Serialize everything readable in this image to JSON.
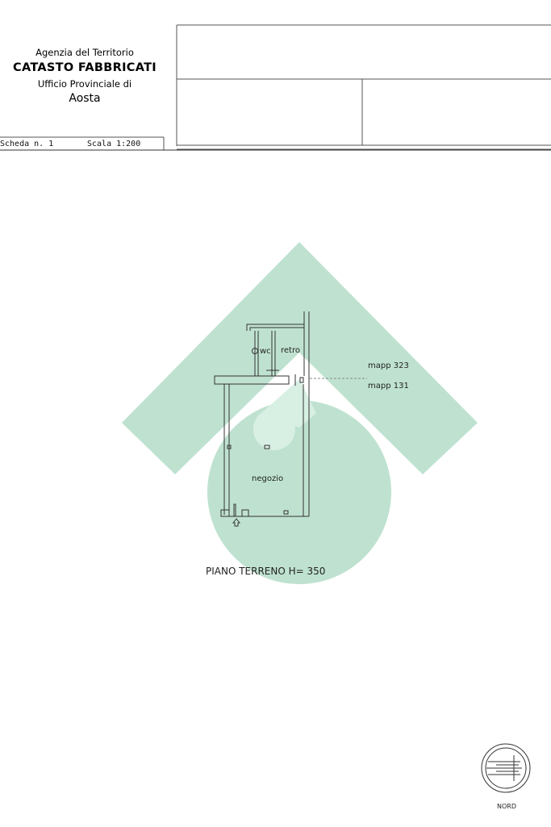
{
  "header": {
    "agency": "Agenzia del Territorio",
    "catasto": "CATASTO FABBRICATI",
    "ufficio": "Ufficio Provinciale di",
    "city": "Aosta",
    "scheda": "Scheda n. 1",
    "scala": "Scala 1:200"
  },
  "plan": {
    "rooms": {
      "wc": "wc",
      "retro": "retro",
      "negozio": "negozio"
    },
    "parcels": {
      "upper": "mapp 323",
      "lower": "mapp 131"
    },
    "floor_label": "PIANO TERRENO H= 350"
  },
  "compass": {
    "label": "NORD"
  },
  "watermark": {
    "color": "#bfe2d0",
    "icon": "house-pin-logo"
  }
}
